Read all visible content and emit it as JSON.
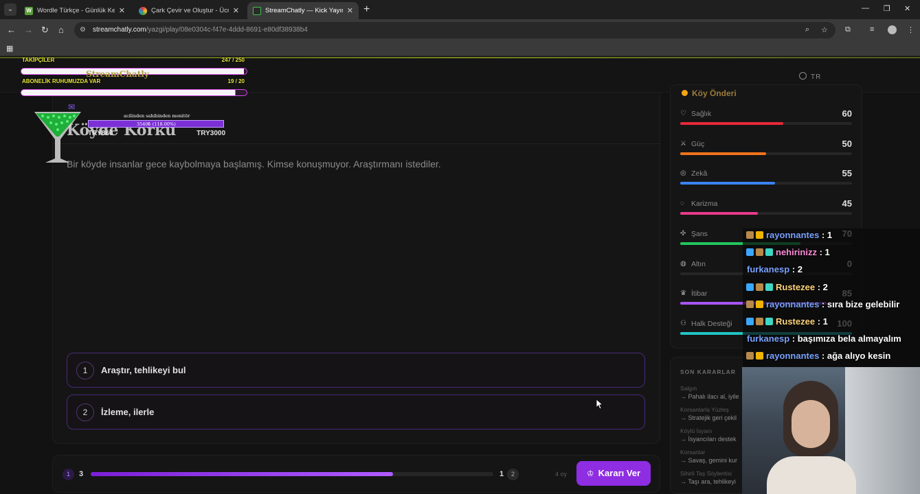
{
  "browser": {
    "tabs": [
      {
        "title": "Wordle Türkçe - Günlük Kelime",
        "favicon": "W"
      },
      {
        "title": "Çark Çevir ve Oluştur - Ücretsiz",
        "favicon": "●"
      },
      {
        "title": "StreamChatly — Kick Yayıncıları",
        "favicon": "□"
      }
    ],
    "url_host": "streamchatly.com",
    "url_path": "/yazgi/play/08e0304c-f47e-4ddd-8691-e80df38938b4"
  },
  "header": {
    "lang": "TR"
  },
  "overlay": {
    "followers_label": "TAKİPÇİLER",
    "followers_count": "247 / 250",
    "followers_progress": 0.988,
    "subs_label": "ABONELİK RUHUMUZDA VAR",
    "subs_count": "19 / 20",
    "subs_progress": 0.95,
    "brand": "StreamChatly",
    "donation_caption": "acilinden sahibinden monitör",
    "donation_amount": "3540₺ (118.00%)",
    "donation_min": "TRY860",
    "donation_max": "TRY3000"
  },
  "story": {
    "title": "Köyde Korku",
    "text": "Bir köyde insanlar gece kaybolmaya başlamış. Kimse konuşmuyor. Araştırmanı istediler."
  },
  "choices": [
    {
      "num": "1",
      "label": "Araştır, tehlikeyi bul"
    },
    {
      "num": "2",
      "label": "İzleme, ilerle"
    }
  ],
  "vote": {
    "opt1_num": "1",
    "opt1_count": "3",
    "opt2_count": "1",
    "opt2_num": "2",
    "progress": 0.75,
    "total": "4 oy",
    "button": "Kararı Ver"
  },
  "stats_panel": {
    "title": "Köy Önderi",
    "items": [
      {
        "name": "Sağlık",
        "value": "60",
        "fill": 0.6,
        "color": "#e8283a",
        "icon": "heart-icon",
        "glyph": "♡"
      },
      {
        "name": "Güç",
        "value": "50",
        "fill": 0.5,
        "color": "#f0741c",
        "icon": "sword-icon",
        "glyph": "⚔"
      },
      {
        "name": "Zekâ",
        "value": "55",
        "fill": 0.55,
        "color": "#3b82f6",
        "icon": "brain-icon",
        "glyph": "◎"
      },
      {
        "name": "Karizma",
        "value": "45",
        "fill": 0.45,
        "color": "#e83a8a",
        "icon": "speech-icon",
        "glyph": "◌"
      },
      {
        "name": "Şans",
        "value": "70",
        "fill": 0.7,
        "color": "#22c55e",
        "icon": "clover-icon",
        "glyph": "✣"
      },
      {
        "name": "Altın",
        "value": "0",
        "fill": 0.0,
        "color": "#eab308",
        "icon": "coins-icon",
        "glyph": "◍"
      },
      {
        "name": "İtibar",
        "value": "85",
        "fill": 0.85,
        "color": "#a855f7",
        "icon": "crown-icon",
        "glyph": "♛"
      },
      {
        "name": "Halk Desteği",
        "value": "100",
        "fill": 1.0,
        "color": "#22c5c5",
        "icon": "people-icon",
        "glyph": "⚇"
      }
    ]
  },
  "recent": {
    "title": "SON KARARLAR",
    "items": [
      {
        "title": "Salgın",
        "decision": "→ Pahalı ilacı al, iyile"
      },
      {
        "title": "Korsanlarla Yüzleş",
        "decision": "→ Stratejik geri çekil"
      },
      {
        "title": "Köylü İsyanı",
        "decision": "→ İsyancıları destek"
      },
      {
        "title": "Korsanlar",
        "decision": "→ Savaş, gemini kur"
      },
      {
        "title": "Sihirli Taş Söylentisi",
        "decision": "→ Taşı ara, tehlikeyi"
      }
    ]
  },
  "chat": [
    {
      "user": "rayonnantes",
      "text": " : 1",
      "color": "#7aa2ff",
      "badges": [
        "#b8894a",
        "#f0b400"
      ]
    },
    {
      "user": "nehirinizz",
      "text": " : 1",
      "color": "#ff8ad8",
      "badges": [
        "#3ba7ff",
        "#b8894a",
        "#3dd6c4"
      ]
    },
    {
      "user": "furkanesp",
      "text": " : 2",
      "color": "#7aa2ff",
      "badges": []
    },
    {
      "user": "Rustezee",
      "text": " : 2",
      "color": "#ffd37a",
      "badges": [
        "#3ba7ff",
        "#b8894a",
        "#3dd6c4"
      ]
    },
    {
      "user": "rayonnantes",
      "text": " : sıra bize gelebilir",
      "color": "#7aa2ff",
      "badges": [
        "#b8894a",
        "#f0b400"
      ]
    },
    {
      "user": "Rustezee",
      "text": " : 1",
      "color": "#ffd37a",
      "badges": [
        "#3ba7ff",
        "#b8894a",
        "#3dd6c4"
      ]
    },
    {
      "user": "furkanesp",
      "text": " : başımıza bela almayalım",
      "color": "#7aa2ff",
      "badges": []
    },
    {
      "user": "rayonnantes",
      "text": " : ağa alıyo kesin",
      "color": "#7aa2ff",
      "badges": [
        "#b8894a",
        "#f0b400"
      ]
    }
  ]
}
